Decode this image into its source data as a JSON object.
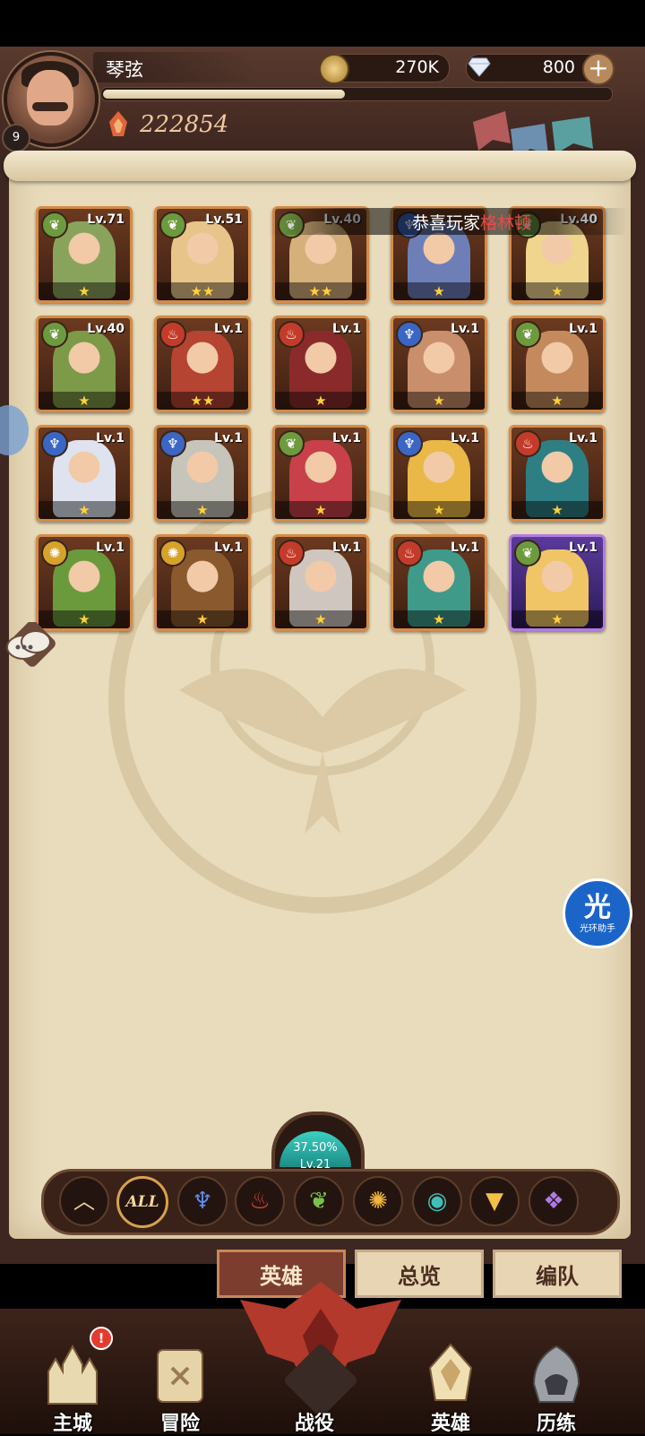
{
  "player": {
    "name": "琴弦",
    "level": "9",
    "power": "222854",
    "exp_fraction": 0.48
  },
  "resources": {
    "gold": "270K",
    "gems": "800",
    "add_symbol": "+"
  },
  "banner": {
    "prefix": "恭喜玩家",
    "name": "格林顿"
  },
  "heroes": [
    {
      "level": "Lv.71",
      "element": "nature",
      "stars": 1,
      "color": "#8aa35c"
    },
    {
      "level": "Lv.51",
      "element": "nature",
      "stars": 2,
      "color": "#e7c58a"
    },
    {
      "level": "Lv.40",
      "element": "nature",
      "stars": 2,
      "color": "#d6b07a"
    },
    {
      "level": "",
      "element": "water",
      "stars": 1,
      "color": "#6e7fb8"
    },
    {
      "level": "Lv.40",
      "element": "nature",
      "stars": 1,
      "color": "#f0d58e"
    },
    {
      "level": "Lv.40",
      "element": "nature",
      "stars": 1,
      "color": "#7c9a48"
    },
    {
      "level": "Lv.1",
      "element": "fire",
      "stars": 2,
      "color": "#b54432"
    },
    {
      "level": "Lv.1",
      "element": "fire",
      "stars": 1,
      "color": "#8b2a2a"
    },
    {
      "level": "Lv.1",
      "element": "water",
      "stars": 1,
      "color": "#c98e6b"
    },
    {
      "level": "Lv.1",
      "element": "nature",
      "stars": 1,
      "color": "#c48a5e"
    },
    {
      "level": "Lv.1",
      "element": "water",
      "stars": 1,
      "color": "#dfe3ef"
    },
    {
      "level": "Lv.1",
      "element": "water",
      "stars": 1,
      "color": "#c7c4bb"
    },
    {
      "level": "Lv.1",
      "element": "nature",
      "stars": 1,
      "color": "#c7404a"
    },
    {
      "level": "Lv.1",
      "element": "water",
      "stars": 1,
      "color": "#e9b846"
    },
    {
      "level": "Lv.1",
      "element": "fire",
      "stars": 1,
      "color": "#2e7f83"
    },
    {
      "level": "Lv.1",
      "element": "light",
      "stars": 1,
      "color": "#6b9a3c"
    },
    {
      "level": "Lv.1",
      "element": "light",
      "stars": 1,
      "color": "#8a5a2e"
    },
    {
      "level": "Lv.1",
      "element": "fire",
      "stars": 1,
      "color": "#cfc7bf"
    },
    {
      "level": "Lv.1",
      "element": "fire",
      "stars": 1,
      "color": "#3f9a8a"
    },
    {
      "level": "Lv.1",
      "element": "nature",
      "stars": 1,
      "color": "#f0c565",
      "purple": true
    }
  ],
  "element_colors": {
    "nature": "#6e9a3e",
    "fire": "#c43b2a",
    "water": "#3b66c4",
    "light": "#d6a32a"
  },
  "level_orb": {
    "percent": "37.50%",
    "level": "Lv.21"
  },
  "filters": [
    {
      "name": "collapse",
      "glyph": "︿",
      "color": "#f3d7a0"
    },
    {
      "name": "all",
      "glyph": "ALL",
      "color": "#f3d7a0"
    },
    {
      "name": "water",
      "glyph": "♆",
      "color": "#5d8ef0"
    },
    {
      "name": "fire",
      "glyph": "♨",
      "color": "#e04a36"
    },
    {
      "name": "nature",
      "glyph": "❦",
      "color": "#79c24a"
    },
    {
      "name": "light",
      "glyph": "✺",
      "color": "#f0b53a"
    },
    {
      "name": "mystic",
      "glyph": "◉",
      "color": "#3fc0b5"
    },
    {
      "name": "celestial",
      "glyph": "▼",
      "color": "#f2c045"
    },
    {
      "name": "void",
      "glyph": "❖",
      "color": "#b07be8"
    }
  ],
  "tabs": {
    "heroes": "英雄",
    "overview": "总览",
    "team": "编队"
  },
  "helper": {
    "char": "光",
    "label": "光环助手"
  },
  "bottom_nav": {
    "city": "主城",
    "adventure": "冒险",
    "campaign": "战役",
    "heroes": "英雄",
    "trials": "历练",
    "badge": "!"
  }
}
